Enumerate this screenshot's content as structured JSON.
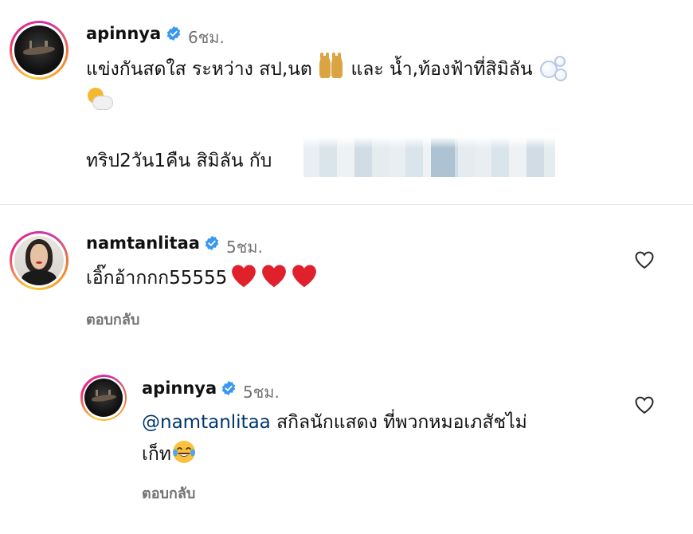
{
  "post": {
    "username": "apinnya",
    "time": "6ชม.",
    "caption_line1_a": "แข่งกันสดใส ระหว่าง สป,นต",
    "caption_line1_b": "และ น้ำ,ท้องฟ้าที่สิมิลัน",
    "caption_line3": "ทริป2วัน1คืน สิมิลัน กับ"
  },
  "comments": [
    {
      "username": "namtanlitaa",
      "time": "5ชม.",
      "text": "เอิ๊กอ้ากกก55555",
      "reply_label": "ตอบกลับ"
    }
  ],
  "replies": [
    {
      "username": "apinnya",
      "time": "5ชม.",
      "mention": "@namtanlitaa",
      "text_line1": " สกิลนักแสดง ที่พวกหมอเภสัชไม่",
      "text_line2": "เก็ท",
      "reply_label": "ตอบกลับ"
    }
  ],
  "icons": {
    "verified": "verified-badge-icon",
    "like": "heart-outline-icon",
    "emoji": [
      "dancing-women-emoji",
      "bubbles-emoji",
      "sun-behind-cloud-emoji",
      "red-heart-emoji",
      "tears-of-joy-emoji"
    ]
  },
  "colors": {
    "verified_blue": "#3897f0",
    "muted_text": "#737373",
    "mention": "#00376b",
    "heart_red": "#e0202a"
  }
}
